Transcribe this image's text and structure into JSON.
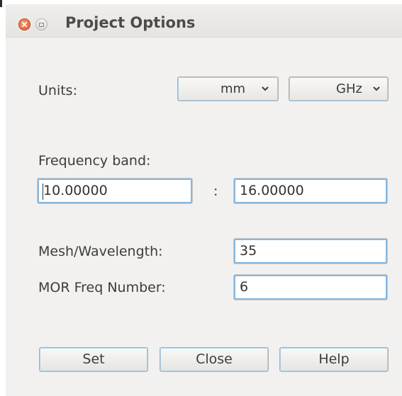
{
  "window": {
    "title": "Project Options"
  },
  "units": {
    "label": "Units:",
    "length": {
      "selected": "mm"
    },
    "frequency": {
      "selected": "GHz"
    }
  },
  "frequency_band": {
    "label": "Frequency band:",
    "start": "10.00000",
    "separator": ":",
    "end": "16.00000"
  },
  "mesh": {
    "label": "Mesh/Wavelength:",
    "value": "35"
  },
  "mor": {
    "label": "MOR Freq Number:",
    "value": "6"
  },
  "buttons": {
    "set": "Set",
    "close": "Close",
    "help": "Help"
  },
  "icons": {
    "close": "close-icon",
    "maximize": "maximize-icon",
    "dropdown": "chevron-down-icon"
  },
  "colors": {
    "close_button": "#e2572d",
    "focus_border": "#86b7de"
  }
}
